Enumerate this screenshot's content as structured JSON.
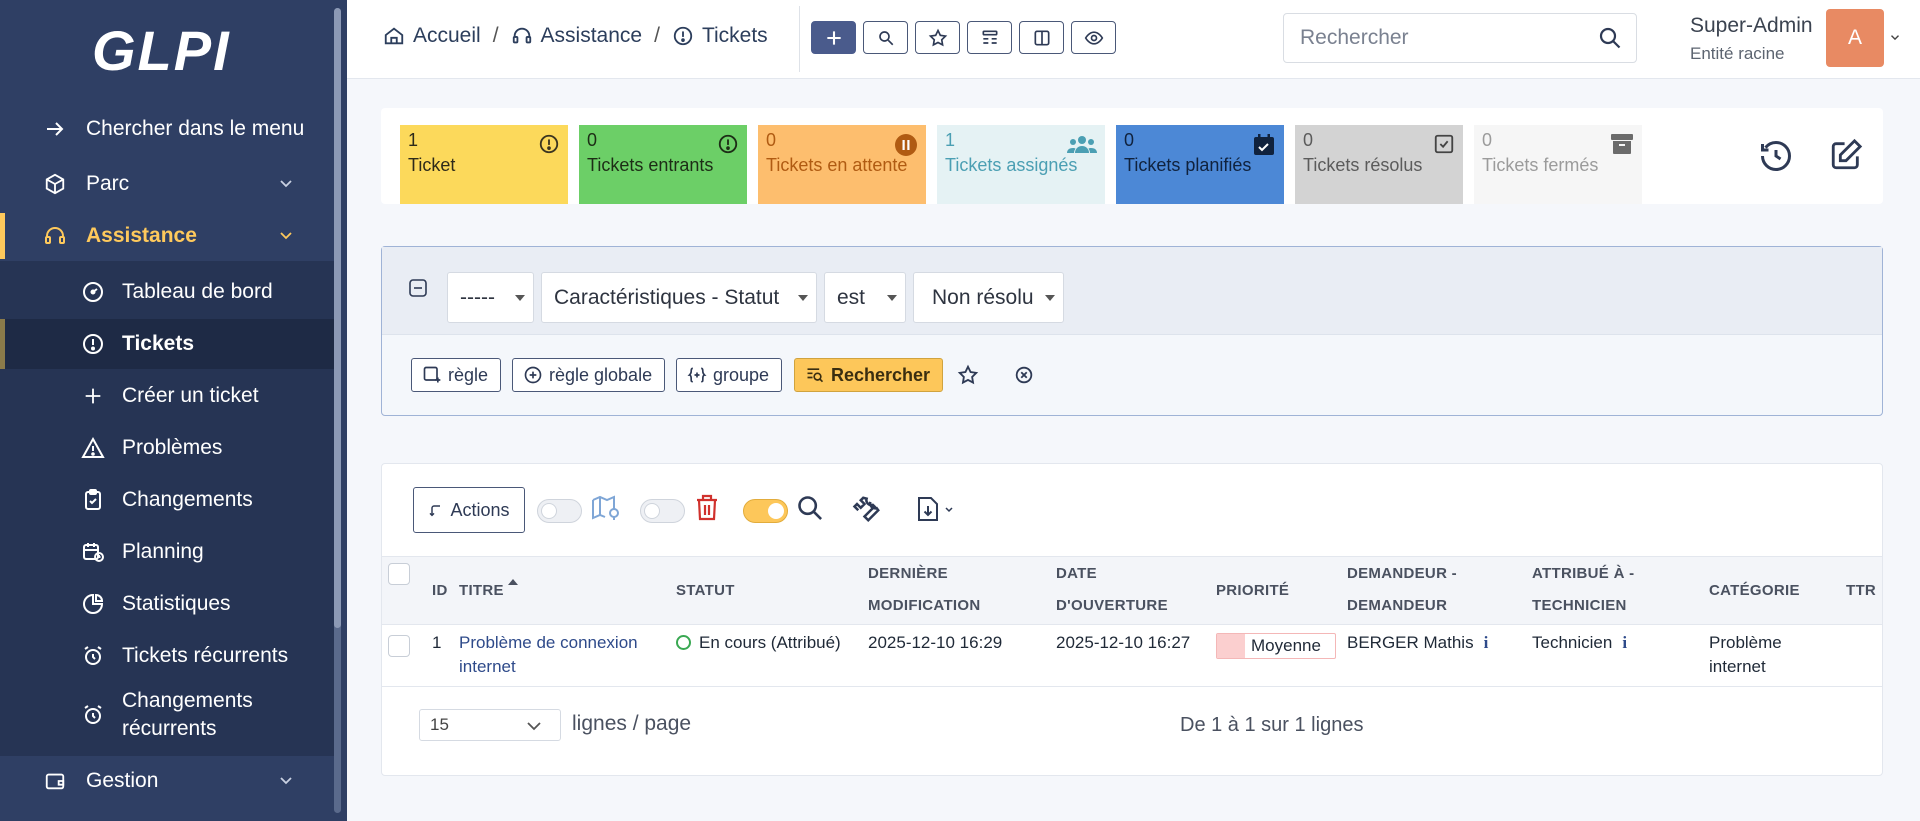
{
  "app": {
    "logo": "GLPI"
  },
  "sidebar": {
    "search_menu": "Chercher dans le menu",
    "sections": [
      {
        "label": "Parc"
      },
      {
        "label": "Assistance"
      },
      {
        "label": "Gestion"
      }
    ],
    "assistance_items": [
      {
        "label": "Tableau de bord"
      },
      {
        "label": "Tickets"
      },
      {
        "label": "Créer un ticket"
      },
      {
        "label": "Problèmes"
      },
      {
        "label": "Changements"
      },
      {
        "label": "Planning"
      },
      {
        "label": "Statistiques"
      },
      {
        "label": "Tickets récurrents"
      },
      {
        "label_line1": "Changements",
        "label_line2": "récurrents"
      }
    ]
  },
  "header": {
    "breadcrumb": [
      "Accueil",
      "Assistance",
      "Tickets"
    ],
    "separator": "/",
    "search_placeholder": "Rechercher",
    "user_name": "Super-Admin",
    "user_entity": "Entité racine",
    "avatar_letter": "A"
  },
  "tiles": [
    {
      "count": "1",
      "label": "Ticket",
      "bg": "#fcd95b",
      "color": "#2d2a1a"
    },
    {
      "count": "0",
      "label": "Tickets entrants",
      "bg": "#6ccf67",
      "color": "#1d2d16"
    },
    {
      "count": "0",
      "label": "Tickets en attente",
      "bg": "#fdbe6e",
      "color": "#b05b12"
    },
    {
      "count": "1",
      "label": "Tickets assignés",
      "bg": "#e5f2f4",
      "color": "#4b9fb3"
    },
    {
      "count": "0",
      "label": "Tickets planifiés",
      "bg": "#4c88d6",
      "color": "#10223d"
    },
    {
      "count": "0",
      "label": "Tickets résolus",
      "bg": "#d3d3d3",
      "color": "#5b5b5b"
    },
    {
      "count": "0",
      "label": "Tickets fermés",
      "bg": "#f6f6f6",
      "color": "#9b9b9b"
    }
  ],
  "criteria": {
    "link": "-----",
    "field": "Caractéristiques - Statut",
    "operator": "est",
    "value": "Non résolu",
    "btn_rule": "règle",
    "btn_global_rule": "règle globale",
    "btn_group": "groupe",
    "btn_search": "Rechercher"
  },
  "results": {
    "actions_label": "Actions",
    "columns": [
      {
        "line1": "ID"
      },
      {
        "line1": "Titre"
      },
      {
        "line1": "Statut"
      },
      {
        "line1": "Dernière",
        "line2": "modification"
      },
      {
        "line1": "Date",
        "line2": "d'ouverture"
      },
      {
        "line1": "Priorité"
      },
      {
        "line1": "Demandeur -",
        "line2": "Demandeur"
      },
      {
        "line1": "Attribué à -",
        "line2": "Technicien"
      },
      {
        "line1": "Catégorie"
      },
      {
        "line1": "TTR"
      }
    ],
    "rows": [
      {
        "id": "1",
        "title_line1": "Problème de connexion",
        "title_line2": "internet",
        "status": "En cours (Attribué)",
        "last_modified": "2025-12-10 16:29",
        "opened": "2025-12-10 16:27",
        "priority": "Moyenne",
        "requester": "BERGER Mathis",
        "assigned": "Technicien",
        "category_line1": "Problème",
        "category_line2": "internet"
      }
    ],
    "page_size": "15",
    "page_size_label": "lignes / page",
    "count_text": "De 1 à 1 sur 1 lignes"
  }
}
